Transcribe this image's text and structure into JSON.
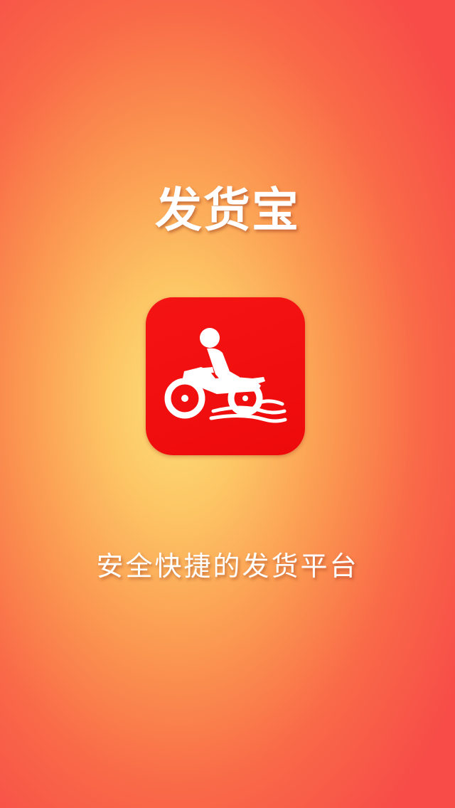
{
  "app": {
    "title": "发货宝",
    "tagline": "安全快捷的发货平台",
    "icon": "motorcycle-courier-icon"
  },
  "colors": {
    "background_center": "#fde07a",
    "background_edge": "#f74c48",
    "icon_background": "#f51414",
    "text": "#ffffff"
  }
}
